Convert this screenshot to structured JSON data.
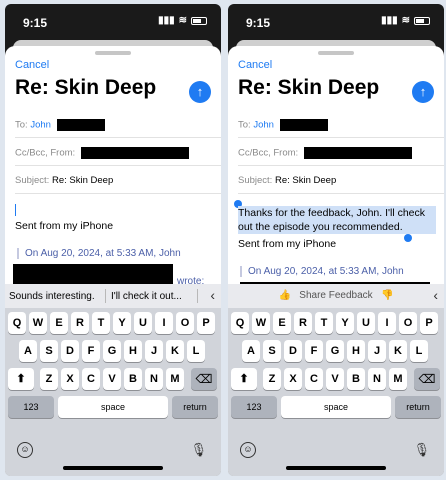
{
  "status": {
    "time": "9:15",
    "signal": "▮▮▮",
    "wifi": "≋"
  },
  "email": {
    "cancel_label": "Cancel",
    "title": "Re: Skin Deep",
    "send_icon": "arrow-up-icon",
    "to_label": "To:",
    "to_value": "John",
    "ccbcc_label": "Cc/Bcc, From:",
    "subject_label": "Subject:",
    "subject_value": "Re: Skin Deep",
    "signature": "Sent from my iPhone",
    "quote_header": "On Aug 20, 2024, at 5:33 AM, John",
    "quote_wrote": "wrote:",
    "typed_text": "Thanks for the feedback, John. I'll check out the episode you recommended."
  },
  "keyboard": {
    "predictions": [
      "Sounds interesting.",
      "I'll check it out..."
    ],
    "feedback_label": "Share Feedback",
    "row1": [
      "Q",
      "W",
      "E",
      "R",
      "T",
      "Y",
      "U",
      "I",
      "O",
      "P"
    ],
    "row2": [
      "A",
      "S",
      "D",
      "F",
      "G",
      "H",
      "J",
      "K",
      "L"
    ],
    "row3": [
      "Z",
      "X",
      "C",
      "V",
      "B",
      "N",
      "M"
    ],
    "numbers_label": "123",
    "space_label": "space",
    "return_label": "return",
    "shift_glyph": "⬆",
    "delete_glyph": "⌫",
    "emoji_glyph": "☺",
    "mic_glyph": "🎙",
    "chevron_glyph": "‹"
  },
  "colors": {
    "accent": "#1f7bf2",
    "selection": "#cfe0f7"
  }
}
